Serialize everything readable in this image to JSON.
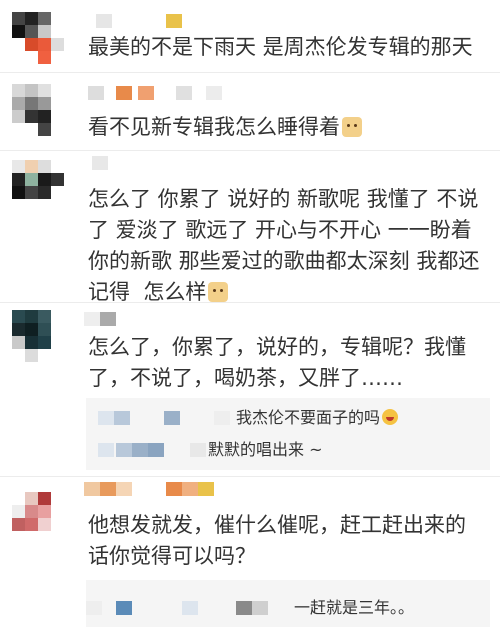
{
  "comments": [
    {
      "text": "最美的不是下雨天 是周杰伦发专辑的那天",
      "emoji": null
    },
    {
      "text": "看不见新专辑我怎么睡得着",
      "emoji": "doge-emoji"
    },
    {
      "text": "怎么了 你累了 说好的 新歌呢 我懂了 不说了 爱淡了 歌远了 开心与不开心 一一盼着你的新歌 那些爱过的歌曲都太深刻 我都还记得  怎么样",
      "emoji": "cat-emoji"
    },
    {
      "text": "怎么了，你累了，说好的，专辑呢？我懂了，不说了，喝奶茶，又胖了……",
      "emoji": null
    },
    {
      "text": "他想发就发，催什么催呢，赶工赶出来的话你觉得可以吗？",
      "emoji": null
    }
  ],
  "replies": {
    "r1": {
      "text": "我杰伦不要面子的吗",
      "emoji": "laugh-emoji"
    },
    "r2": {
      "text": "默默的唱出来 ~"
    },
    "r3": {
      "text": "一赶就是三年。。"
    }
  },
  "colors": {
    "text": "#333333",
    "reply_bg": "#f5f5f5",
    "pixel_palette": [
      "#1a1a1a",
      "#8a8a8a",
      "#cfcfcf",
      "#d84b2a",
      "#e89a5c",
      "#5b8bb8",
      "#1f3b3f",
      "#8fb3a0"
    ]
  }
}
